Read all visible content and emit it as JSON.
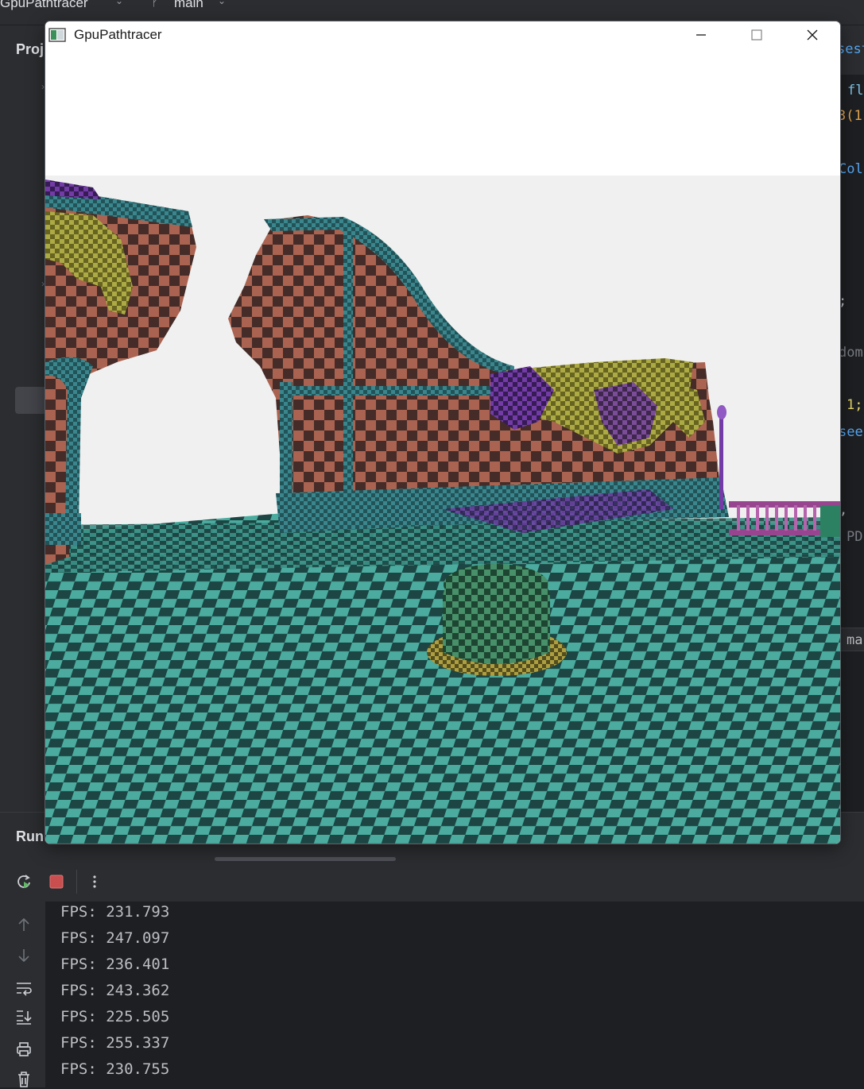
{
  "ide": {
    "project_name": "GpuPathtracer",
    "branch": "main",
    "project_panel_label": "Proj",
    "editor_code_fragments": [
      "sest",
      "fl",
      "3(1",
      "Col",
      ";",
      "dom",
      "1;",
      "see",
      ",",
      "PD",
      "ma"
    ]
  },
  "run_panel": {
    "title": "Run",
    "toolbar": [
      {
        "name": "rerun-icon",
        "tooltip": "Rerun"
      },
      {
        "name": "stop-icon",
        "tooltip": "Stop"
      },
      {
        "name": "more-icon",
        "tooltip": "More"
      }
    ],
    "gutter_icons": [
      "up-arrow-icon",
      "down-arrow-icon",
      "soft-wrap-icon",
      "scroll-to-end-icon",
      "print-icon",
      "trash-icon"
    ],
    "console_lines": [
      "FPS: 231.793",
      "FPS: 247.097",
      "FPS: 236.401",
      "FPS: 243.362",
      "FPS: 225.505",
      "FPS: 255.337",
      "FPS: 230.755"
    ]
  },
  "app_window": {
    "title": "GpuPathtracer",
    "controls": [
      "minimize",
      "maximize",
      "close"
    ],
    "scene_colors": {
      "sky": "#ffffff",
      "brick": "#b56a55",
      "brick_dark": "#3a2a28",
      "trim": "#3f8f96",
      "floor_light": "#4fb6a8",
      "floor_dark": "#1e4a48",
      "hat": "#4c9a70",
      "hat_brim": "#b8a845",
      "foliage_yellow": "#b7b54a",
      "foliage_purple": "#7a3fb0"
    }
  },
  "colors": {
    "ide_bg": "#1e1f22",
    "panel_bg": "#2b2d30",
    "stop_red": "#c94f4f",
    "run_green": "#5fb865"
  }
}
